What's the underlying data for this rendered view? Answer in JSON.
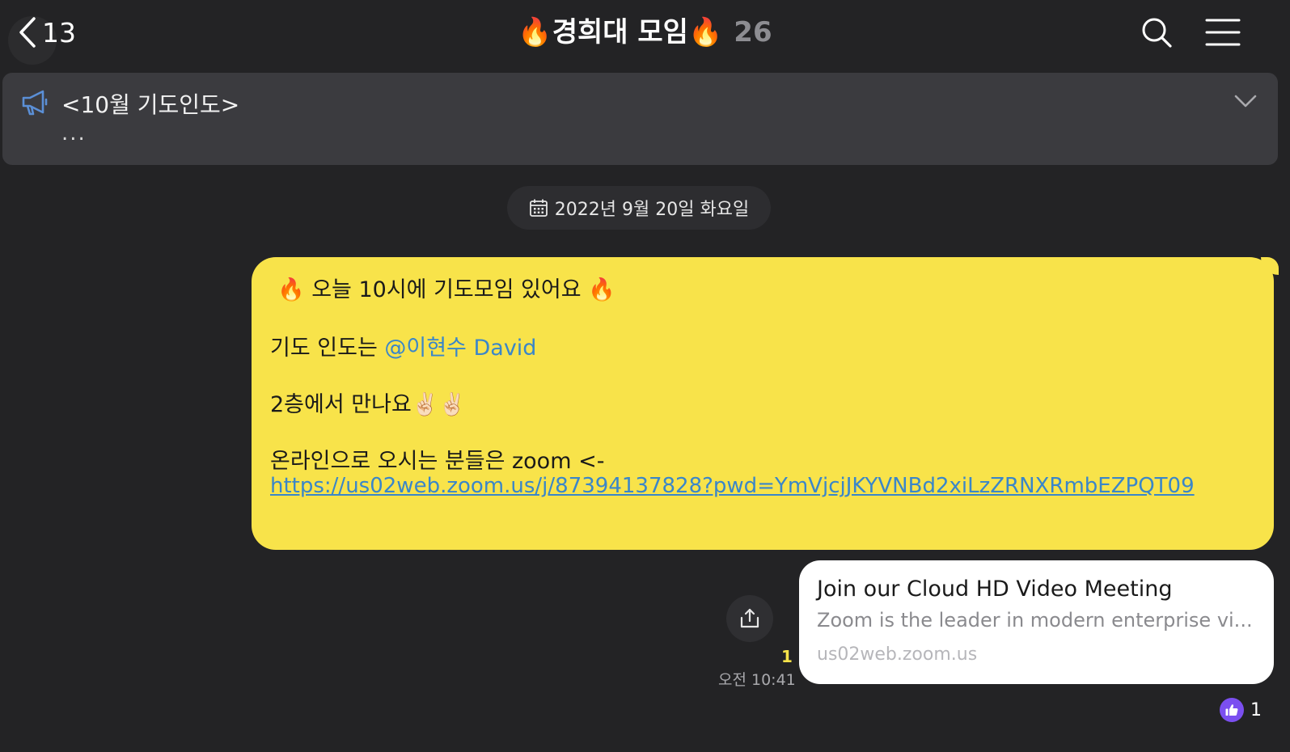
{
  "header": {
    "back_count": "13",
    "title_prefix": "🔥",
    "title": "경희대 모임",
    "title_suffix": "🔥",
    "member_count": "26"
  },
  "notice": {
    "title": "<10월 기도인도>",
    "subtitle": "..."
  },
  "date_divider": "2022년 9월 20일 화요일",
  "message": {
    "line1": "🔥 오늘 10시에 기도모임 있어요 🔥",
    "line2_prefix": "기도 인도는 ",
    "mention": "@이현수 David",
    "line3": "2층에서 만나요✌🏻✌🏻",
    "line4": "온라인으로 오시는 분들은 zoom <-",
    "link": "https://us02web.zoom.us/j/87394137828?pwd=YmVjcjJKYVNBd2xiLzZRNXRmbEZPQT09"
  },
  "link_preview": {
    "title": "Join our Cloud HD Video Meeting",
    "description": "Zoom is the leader in modern enterprise vi...",
    "domain": "us02web.zoom.us"
  },
  "meta": {
    "unread_count": "1",
    "time": "오전 10:41"
  },
  "reaction": {
    "icon": "thumbs-up-icon",
    "count": "1",
    "color": "#7b4ff0"
  },
  "colors": {
    "background": "#232325",
    "bubble": "#f8e34a",
    "link": "#3a86c9",
    "notice_bg": "#3b3b3f"
  }
}
